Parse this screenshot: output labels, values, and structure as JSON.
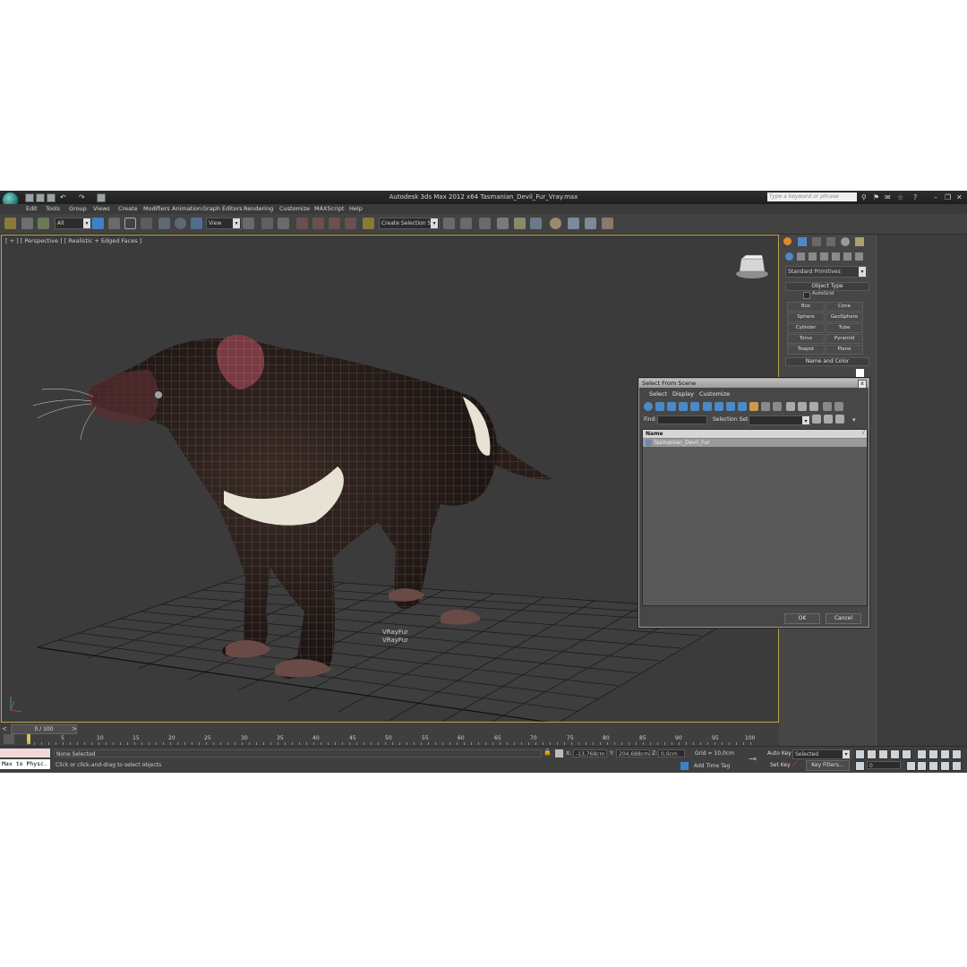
{
  "titlebar": {
    "title": "Autodesk 3ds Max  2012 x64     Tasmanian_Devil_Fur_Vray.max",
    "search_placeholder": "Type a keyword or phrase"
  },
  "menu": [
    "Edit",
    "Tools",
    "Group",
    "Views",
    "Create",
    "Modifiers",
    "Animation",
    "Graph Editors",
    "Rendering",
    "Customize",
    "MAXScript",
    "Help"
  ],
  "toolbar": {
    "selection_filter": "All",
    "ref_coord": "View",
    "named_selection": "Create Selection Se"
  },
  "viewport": {
    "label": "[ + ] [ Perspective ] [ Realistic + Edged Faces ]",
    "object_label": "VRayFur",
    "object_label2": "VRayFur"
  },
  "command_panel": {
    "category": "Standard Primitives",
    "object_type_title": "Object Type",
    "autogrid": "AutoGrid",
    "buttons": [
      "Box",
      "Cone",
      "Sphere",
      "GeoSphere",
      "Cylinder",
      "Tube",
      "Torus",
      "Pyramid",
      "Teapot",
      "Plane"
    ],
    "name_color_title": "Name and Color"
  },
  "dialog": {
    "title": "Select From Scene",
    "close": "x",
    "menus": [
      "Select",
      "Display",
      "Customize"
    ],
    "find_label": "Find:",
    "selection_set_label": "Selection Set:",
    "column_name": "Name",
    "items": [
      "Tasmanian_Devil_Fur"
    ],
    "ok": "OK",
    "cancel": "Cancel"
  },
  "timeline": {
    "frame_counter": "0 / 100",
    "ticks": [
      "0",
      "5",
      "10",
      "15",
      "20",
      "25",
      "30",
      "35",
      "40",
      "45",
      "50",
      "55",
      "60",
      "65",
      "70",
      "75",
      "80",
      "85",
      "90",
      "95",
      "100"
    ]
  },
  "status": {
    "maxscript": "Max to Physc.",
    "selection": "None Selected",
    "prompt": "Click or click-and-drag to select objects",
    "x_label": "X:",
    "x_value": "-13,768cm",
    "y_label": "Y:",
    "y_value": "204,688cm",
    "z_label": "Z:",
    "z_value": "0,0cm",
    "grid": "Grid = 10,0cm",
    "add_time_tag": "Add Time Tag",
    "auto_key": "Auto Key",
    "selected": "Selected",
    "set_key": "Set Key",
    "key_filters": "Key Filters...",
    "frame": "0"
  },
  "colors": {
    "accent_blue": "#3b82c8",
    "viewport_border": "#b8a44c",
    "animal_body": "#241a17"
  }
}
